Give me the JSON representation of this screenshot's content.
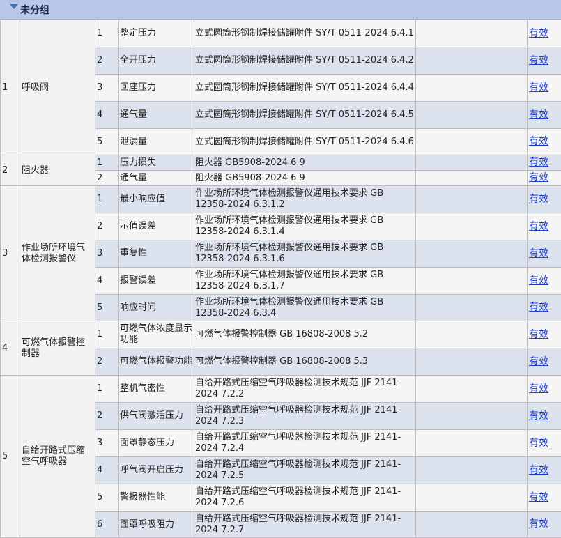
{
  "group": {
    "title": "未分组"
  },
  "rows": [
    {
      "idx": "1",
      "name": "呼吸阀",
      "sub": [
        {
          "n": "1",
          "param": "整定压力",
          "std": "立式圆筒形钢制焊接储罐附件 SY/T 0511-2024 6.4.1",
          "status": "有效"
        },
        {
          "n": "2",
          "param": "全开压力",
          "std": "立式圆筒形钢制焊接储罐附件 SY/T 0511-2024 6.4.2",
          "status": "有效"
        },
        {
          "n": "3",
          "param": "回座压力",
          "std": "立式圆筒形钢制焊接储罐附件 SY/T 0511-2024 6.4.4",
          "status": "有效"
        },
        {
          "n": "4",
          "param": "通气量",
          "std": "立式圆筒形钢制焊接储罐附件 SY/T 0511-2024 6.4.5",
          "status": "有效"
        },
        {
          "n": "5",
          "param": "泄漏量",
          "std": "立式圆筒形钢制焊接储罐附件 SY/T 0511-2024 6.4.6",
          "status": "有效"
        }
      ]
    },
    {
      "idx": "2",
      "name": "阻火器",
      "sub": [
        {
          "n": "1",
          "param": "压力损失",
          "std": "阻火器 GB5908-2024 6.9",
          "status": "有效"
        },
        {
          "n": "2",
          "param": "通气量",
          "std": "阻火器 GB5908-2024 6.9",
          "status": "有效"
        }
      ]
    },
    {
      "idx": "3",
      "name": "作业场所环境气体检测报警仪",
      "sub": [
        {
          "n": "1",
          "param": "最小响应值",
          "std": "作业场所环境气体检测报警仪通用技术要求 GB 12358-2024 6.3.1.2",
          "status": "有效"
        },
        {
          "n": "2",
          "param": "示值误差",
          "std": "作业场所环境气体检测报警仪通用技术要求 GB 12358-2024 6.3.1.4",
          "status": "有效"
        },
        {
          "n": "3",
          "param": "重复性",
          "std": "作业场所环境气体检测报警仪通用技术要求 GB 12358-2024 6.3.1.6",
          "status": "有效"
        },
        {
          "n": "4",
          "param": "报警误差",
          "std": "作业场所环境气体检测报警仪通用技术要求 GB 12358-2024 6.3.1.7",
          "status": "有效"
        },
        {
          "n": "5",
          "param": "响应时间",
          "std": "作业场所环境气体检测报警仪通用技术要求 GB 12358-2024 6.3.4",
          "status": "有效"
        }
      ]
    },
    {
      "idx": "4",
      "name": "可燃气体报警控制器",
      "sub": [
        {
          "n": "1",
          "param": "可燃气体浓度显示功能",
          "std": "可燃气体报警控制器 GB 16808-2008 5.2",
          "status": "有效"
        },
        {
          "n": "2",
          "param": "可燃气体报警功能",
          "std": "可燃气体报警控制器 GB 16808-2008 5.3",
          "status": "有效"
        }
      ]
    },
    {
      "idx": "5",
      "name": "自给开路式压缩空气呼吸器",
      "sub": [
        {
          "n": "1",
          "param": "整机气密性",
          "std": "自给开路式压缩空气呼吸器检测技术规范 JJF 2141-2024  7.2.2",
          "status": "有效"
        },
        {
          "n": "2",
          "param": "供气阀激活压力",
          "std": "自给开路式压缩空气呼吸器检测技术规范 JJF 2141-2024  7.2.3",
          "status": "有效"
        },
        {
          "n": "3",
          "param": "面罩静态压力",
          "std": "自给开路式压缩空气呼吸器检测技术规范 JJF 2141-2024  7.2.4",
          "status": "有效"
        },
        {
          "n": "4",
          "param": "呼气阀开启压力",
          "std": "自给开路式压缩空气呼吸器检测技术规范 JJF 2141-2024  7.2.5",
          "status": "有效"
        },
        {
          "n": "5",
          "param": "警报器性能",
          "std": "自给开路式压缩空气呼吸器检测技术规范 JJF 2141-2024  7.2.6",
          "status": "有效"
        },
        {
          "n": "6",
          "param": "面罩呼吸阻力",
          "std": "自给开路式压缩空气呼吸器检测技术规范 JJF 2141-2024  7.2.7",
          "status": "有效"
        }
      ]
    }
  ]
}
